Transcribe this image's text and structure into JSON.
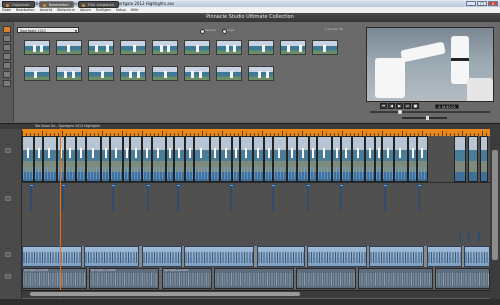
{
  "window": {
    "title": "Pinnacle Studio Ultimate Collection - Tae Kwon Do - Sportgala 2012 Highlights.axs",
    "minimize": "_",
    "maximize": "□",
    "close": "x"
  },
  "menu": [
    "Datei",
    "Bearbeiten",
    "Ansicht",
    "Bildschirm",
    "Album",
    "Einfügen",
    "Setup",
    "Hilfe"
  ],
  "tabs": [
    {
      "label": "Organizer"
    },
    {
      "label": "Bearbeiten",
      "active": true
    },
    {
      "label": "Film ausgeben"
    }
  ],
  "brand": "Pinnacle Studio Ultimate Collection",
  "library": {
    "folder": "Sportgala 2012",
    "radio_options": [
      "Szenen",
      "Clips"
    ],
    "count_label": "1-24 von 36"
  },
  "preview": {
    "timecode": "0:18:49:22",
    "transport": [
      "⏮",
      "◀",
      "▶",
      "⏭",
      "■"
    ]
  },
  "timeline": {
    "title": "Tae Kwon Do - Sportgala 2012 Highlights",
    "audio_clips": [
      "Sportgala_Audio01",
      "Sportgala_Audio02",
      "Sportgala_Audio03"
    ]
  },
  "colors": {
    "accent": "#e8891b",
    "clip_blue": "#6ea4d6",
    "background": "#5e5e5e"
  }
}
